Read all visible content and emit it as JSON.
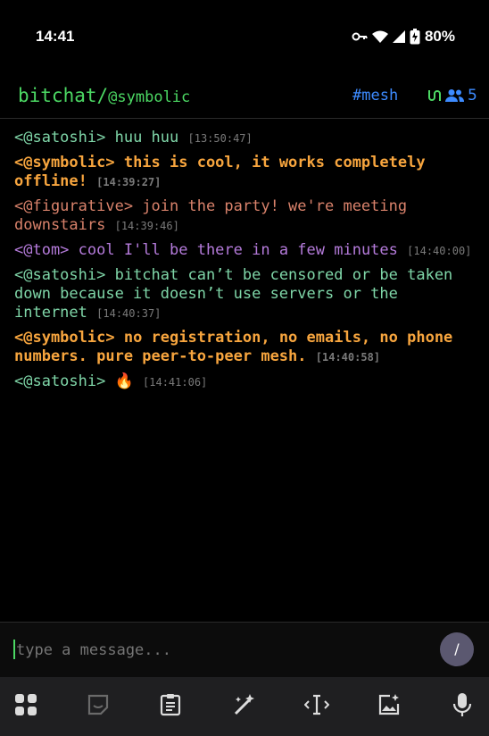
{
  "status_bar": {
    "time": "14:41",
    "battery": "80%"
  },
  "header": {
    "app_name": "bitchat/",
    "nickname": "@symbolic",
    "channel": "#mesh",
    "peer_count": "5"
  },
  "messages": [
    {
      "sender": "<@satoshi>",
      "text": " huu huu",
      "time": "[13:50:47]",
      "style": "c-sat"
    },
    {
      "sender": "<@symbolic>",
      "text": " this is cool, it works completely offline!",
      "time": "[14:39:27]",
      "style": "c-sym"
    },
    {
      "sender": "<@figurative>",
      "text": " join the party! we're meeting downstairs",
      "time": "[14:39:46]",
      "style": "c-fig"
    },
    {
      "sender": "<@tom>",
      "text": " cool I'll be there in a few minutes",
      "time": "[14:40:00]",
      "style": "c-tom"
    },
    {
      "sender": "<@satoshi>",
      "text": " bitchat can’t be censored or be taken down because it doesn’t use servers or the internet",
      "time": "[14:40:37]",
      "style": "c-sat"
    },
    {
      "sender": "<@symbolic>",
      "text": " no registration, no emails, no phone numbers. pure peer-to-peer mesh.",
      "time": "[14:40:58]",
      "style": "c-sym"
    },
    {
      "sender": "<@satoshi>",
      "text": " 🔥",
      "time": "[14:41:06]",
      "style": "c-sat"
    }
  ],
  "composer": {
    "placeholder": "type a message...",
    "send_label": "/"
  },
  "keyboard_toolbar": {
    "items": [
      "apps-icon",
      "sticker-icon",
      "clipboard-icon",
      "magic-edit-icon",
      "text-cursor-icon",
      "image-star-icon",
      "microphone-icon"
    ]
  }
}
